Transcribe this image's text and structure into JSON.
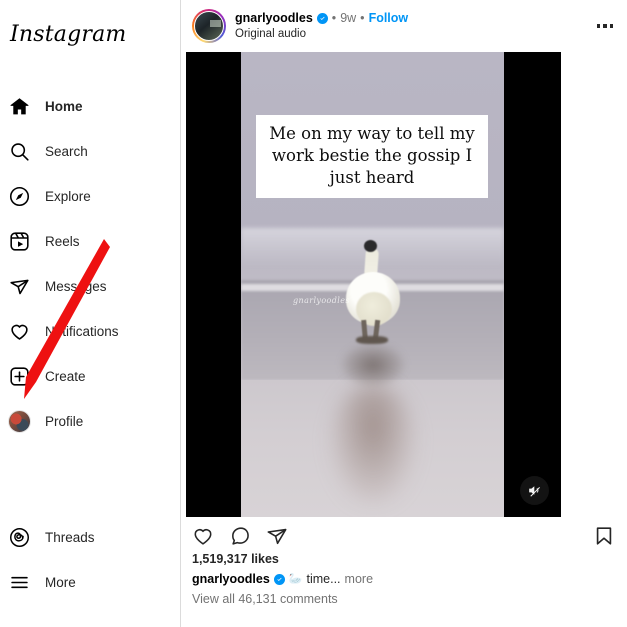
{
  "app": {
    "brand": "Instagram"
  },
  "sidebar": {
    "items": [
      {
        "label": "Home",
        "icon": "home-icon",
        "active": true
      },
      {
        "label": "Search",
        "icon": "search-icon",
        "active": false
      },
      {
        "label": "Explore",
        "icon": "compass-icon",
        "active": false
      },
      {
        "label": "Reels",
        "icon": "reels-icon",
        "active": false
      },
      {
        "label": "Messages",
        "icon": "paper-plane-icon",
        "active": false
      },
      {
        "label": "Notifications",
        "icon": "heart-icon",
        "active": false
      },
      {
        "label": "Create",
        "icon": "plus-square-icon",
        "active": false
      },
      {
        "label": "Profile",
        "icon": "avatar-icon",
        "active": false
      }
    ],
    "bottom_items": [
      {
        "label": "Threads",
        "icon": "threads-icon"
      },
      {
        "label": "More",
        "icon": "hamburger-icon"
      }
    ]
  },
  "post": {
    "author": "gnarlyoodles",
    "verified": true,
    "separator": "•",
    "time_ago": "9w",
    "follow_label": "Follow",
    "audio": "Original audio",
    "menu_icon": "more-options-icon",
    "media": {
      "overlay_text": "Me on my way to tell my work bestie the gossip I just heard",
      "watermark": "gnarlyoodles",
      "mute_icon": "speaker-mute-icon"
    },
    "actions": {
      "like_icon": "heart-icon",
      "comment_icon": "comment-bubble-icon",
      "share_icon": "share-paper-plane-icon",
      "save_icon": "bookmark-icon"
    },
    "likes": "1,519,317 likes",
    "caption_emoji": "🦢",
    "caption_text": "time...",
    "caption_more": "more",
    "view_comments": "View all 46,131 comments"
  },
  "annotation": {
    "arrow_color": "#ee1111",
    "points_to": "Profile"
  }
}
